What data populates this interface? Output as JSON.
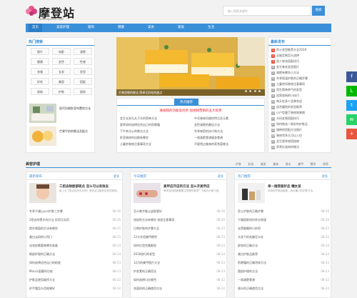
{
  "header": {
    "logo_title": "摩登站",
    "logo_sub": "modengzhan.com",
    "search_placeholder": "输入搜索关键字",
    "search_button": "搜索"
  },
  "nav": [
    "首页",
    "美容护理",
    "服饰",
    "健康",
    "美食",
    "家居",
    "生活"
  ],
  "left_box": {
    "title": "热门搜索",
    "tags": [
      "图片",
      "电影",
      "减肥",
      "健康",
      "女性",
      "性感",
      "衣服",
      "长发",
      "发型",
      "好吃",
      "美容",
      "搭配",
      "收纳",
      "护肤",
      "厨房"
    ],
    "posts": [
      {
        "text": "现代风格卧室布置的方法"
      },
      {
        "text": "芒果牛奶的做法及配方"
      }
    ]
  },
  "slider": {
    "caption": "芒果班戟的做法 简单又好吃的甜点",
    "dots": 4
  },
  "hot_box": {
    "title": "热点推荐",
    "feature": "微视频的功能及优势 短视频营销的五大优势",
    "items": [
      "女生长发扎丸子头的简单方法",
      "夏季如何选择适合自己的防晒霜",
      "下午茶点心的做法大全",
      "卧室装修的风格有哪些",
      "儿童房装修注意事项大全",
      "中式装修风格的特点及元素",
      "女性减肥的最佳方法",
      "冬季穿搭的技巧和方法",
      "一周减肥食谱瘦身食谱",
      "不要错过美味的家常菜做法"
    ]
  },
  "right_box": {
    "title": "最新发布",
    "items": [
      "男士发型推荐大全2019",
      "全屋定制怎么选择",
      "男人穿衣搭配技巧",
      "女生卷发发型图片",
      "减肥有哪些小方法",
      "冬季保湿护肤的正确步骤",
      "儿童房间装修注意事项",
      "男生简单帅气的发型",
      "居家收纳的小技巧",
      "每天吃多少坚果合适",
      "适合圆脸的发型推荐",
      "小户型客厅装修效果图",
      "大码女装搭配技巧",
      "如何挑选一款好的护肤品",
      "旗袍的搭配方法图片",
      "装修完多久可以入住",
      "女生夏季穿搭指南",
      "家常红烧肉的做法"
    ]
  },
  "section": {
    "title": "美容护理",
    "tabs": [
      "护肤",
      "彩妆",
      "美发",
      "美体",
      "香水",
      "美甲",
      "整形",
      "保养"
    ]
  },
  "columns": [
    {
      "label": "最新发布",
      "more": "更多",
      "feat_title": "三招去除脸部斑点 怎么可以有效去",
      "feat_desc": "脸上长了斑点该怎么办呢？很多女生都有这样的烦恼。",
      "items": [
        {
          "t": "冬季干燥山ucc护肤三步骤",
          "d": "08-26"
        },
        {
          "t": "2招去除黑头的方法 好用又实用",
          "d": "08-26"
        },
        {
          "t": "提升颜值的方法有哪些",
          "d": "08-25"
        },
        {
          "t": "美白淡斑的小窍门",
          "d": "08-25"
        },
        {
          "t": "化妆前需要做哪些准备",
          "d": "08-24"
        },
        {
          "t": "眼部护理的正确方法",
          "d": "08-24"
        },
        {
          "t": "如何选择适合自己的粉底",
          "d": "08-23"
        },
        {
          "t": "Mocca面膜的功效",
          "d": "08-23"
        },
        {
          "t": "护肤品使用顺序大全",
          "d": "08-22"
        },
        {
          "t": "护手霜怎么用效果好",
          "d": "08-22"
        }
      ]
    },
    {
      "label": "今日推荐",
      "more": "更多",
      "feat_title": "美甲店开店的方法 怎么开美甲店",
      "feat_desc": "美甲店的经营需要注意哪些事项？下面为大家介绍。",
      "items": [
        {
          "t": "怎么做才能让皮肤更好",
          "d": "08-26"
        },
        {
          "t": "祛斑的方法有哪些 祛斑注意事项",
          "d": "08-26"
        },
        {
          "t": "日常护肤的步骤大全",
          "d": "08-25"
        },
        {
          "t": "12大外搭美甲颜色",
          "d": "08-25"
        },
        {
          "t": "如何打造完美眼妆",
          "d": "08-24"
        },
        {
          "t": "2018流行的发型",
          "d": "08-24"
        },
        {
          "t": "12月的美甲图片大全",
          "d": "08-23"
        },
        {
          "t": "护发素的正确用法",
          "d": "08-23"
        },
        {
          "t": "如何选择口红颜色",
          "d": "08-22"
        },
        {
          "t": "洗面奶的正确使用方法",
          "d": "08-22"
        }
      ]
    },
    {
      "label": "热门推荐",
      "more": "更多",
      "feat_title": "单一推荐面护品 懒女孩",
      "feat_desc": "好用的护肤品推荐，适合懒人的护肤方法。",
      "items": [
        {
          "t": "男士护肤的正确步骤",
          "d": "08-26"
        },
        {
          "t": "干燥肌肤如何补水保湿",
          "d": "08-26"
        },
        {
          "t": "去黑眼圈的小妙招",
          "d": "08-25"
        },
        {
          "t": "头发干枯毛躁怎么办",
          "d": "08-25"
        },
        {
          "t": "卸妆的正确方法",
          "d": "08-24"
        },
        {
          "t": "美白护肤品推荐",
          "d": "08-24"
        },
        {
          "t": "防晒霜的正确涂抹方法",
          "d": "08-23"
        },
        {
          "t": "唇部护理的方法",
          "d": "08-23"
        },
        {
          "t": "一周减肥食谱",
          "d": "08-22"
        },
        {
          "t": "香水的正确使用方法",
          "d": "08-22"
        }
      ]
    }
  ],
  "share": [
    {
      "icon": "facebook-icon",
      "glyph": "f",
      "color": "#3b5998"
    },
    {
      "icon": "line-icon",
      "glyph": "L",
      "color": "#00b900"
    },
    {
      "icon": "twitter-icon",
      "glyph": "t",
      "color": "#1da1f2"
    },
    {
      "icon": "whatsapp-icon",
      "glyph": "w",
      "color": "#25d366"
    },
    {
      "icon": "more-icon",
      "glyph": "+",
      "color": "#e8553f"
    }
  ]
}
